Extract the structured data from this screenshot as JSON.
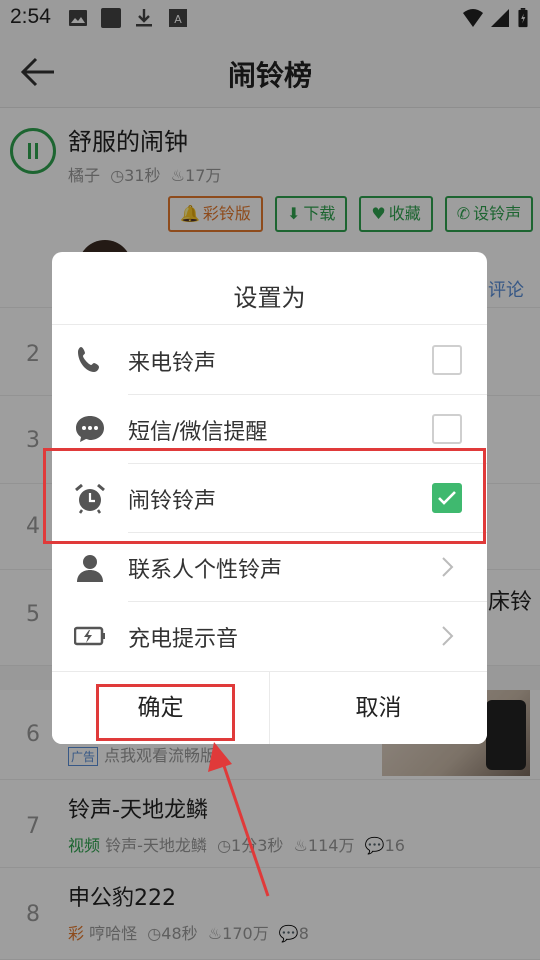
{
  "status_bar": {
    "time": "2:54"
  },
  "header": {
    "title": "闹铃榜"
  },
  "now_playing": {
    "title": "舒服的闹钟",
    "artist": "橘子",
    "duration": "31秒",
    "plays": "17万",
    "actions": [
      "彩铃版",
      "下载",
      "收藏",
      "设铃声"
    ]
  },
  "background_list": {
    "comment_link": "评论",
    "rank_2": "2",
    "rank_3": "3",
    "rank_4": "4",
    "rank_5": "5",
    "rank_5_tail": "床铃",
    "rank_6": "6",
    "ad_tag": "广告",
    "ad_text": "点我观看流畅版",
    "items": [
      {
        "rank": "7",
        "title": "铃声-天地龙鳞",
        "tag": "视频",
        "artist": "铃声-天地龙鳞",
        "duration": "1分3秒",
        "plays": "114万",
        "comments": "16"
      },
      {
        "rank": "8",
        "title": "申公豹222",
        "tag": "彩",
        "artist": "哼哈怪",
        "duration": "48秒",
        "plays": "170万",
        "comments": "8"
      }
    ]
  },
  "dialog": {
    "title": "设置为",
    "options": [
      {
        "label": "来电铃声",
        "control": "checkbox",
        "checked": false,
        "icon": "phone-icon"
      },
      {
        "label": "短信/微信提醒",
        "control": "checkbox",
        "checked": false,
        "icon": "message-icon"
      },
      {
        "label": "闹铃铃声",
        "control": "checkbox",
        "checked": true,
        "icon": "alarm-clock-icon"
      },
      {
        "label": "联系人个性铃声",
        "control": "chevron",
        "icon": "contact-icon"
      },
      {
        "label": "充电提示音",
        "control": "chevron",
        "icon": "battery-charging-icon"
      }
    ],
    "confirm_label": "确定",
    "cancel_label": "取消"
  },
  "colors": {
    "accent_green": "#3fb96f",
    "annotation_red": "#e03a3a",
    "orange": "#e57a2e"
  }
}
